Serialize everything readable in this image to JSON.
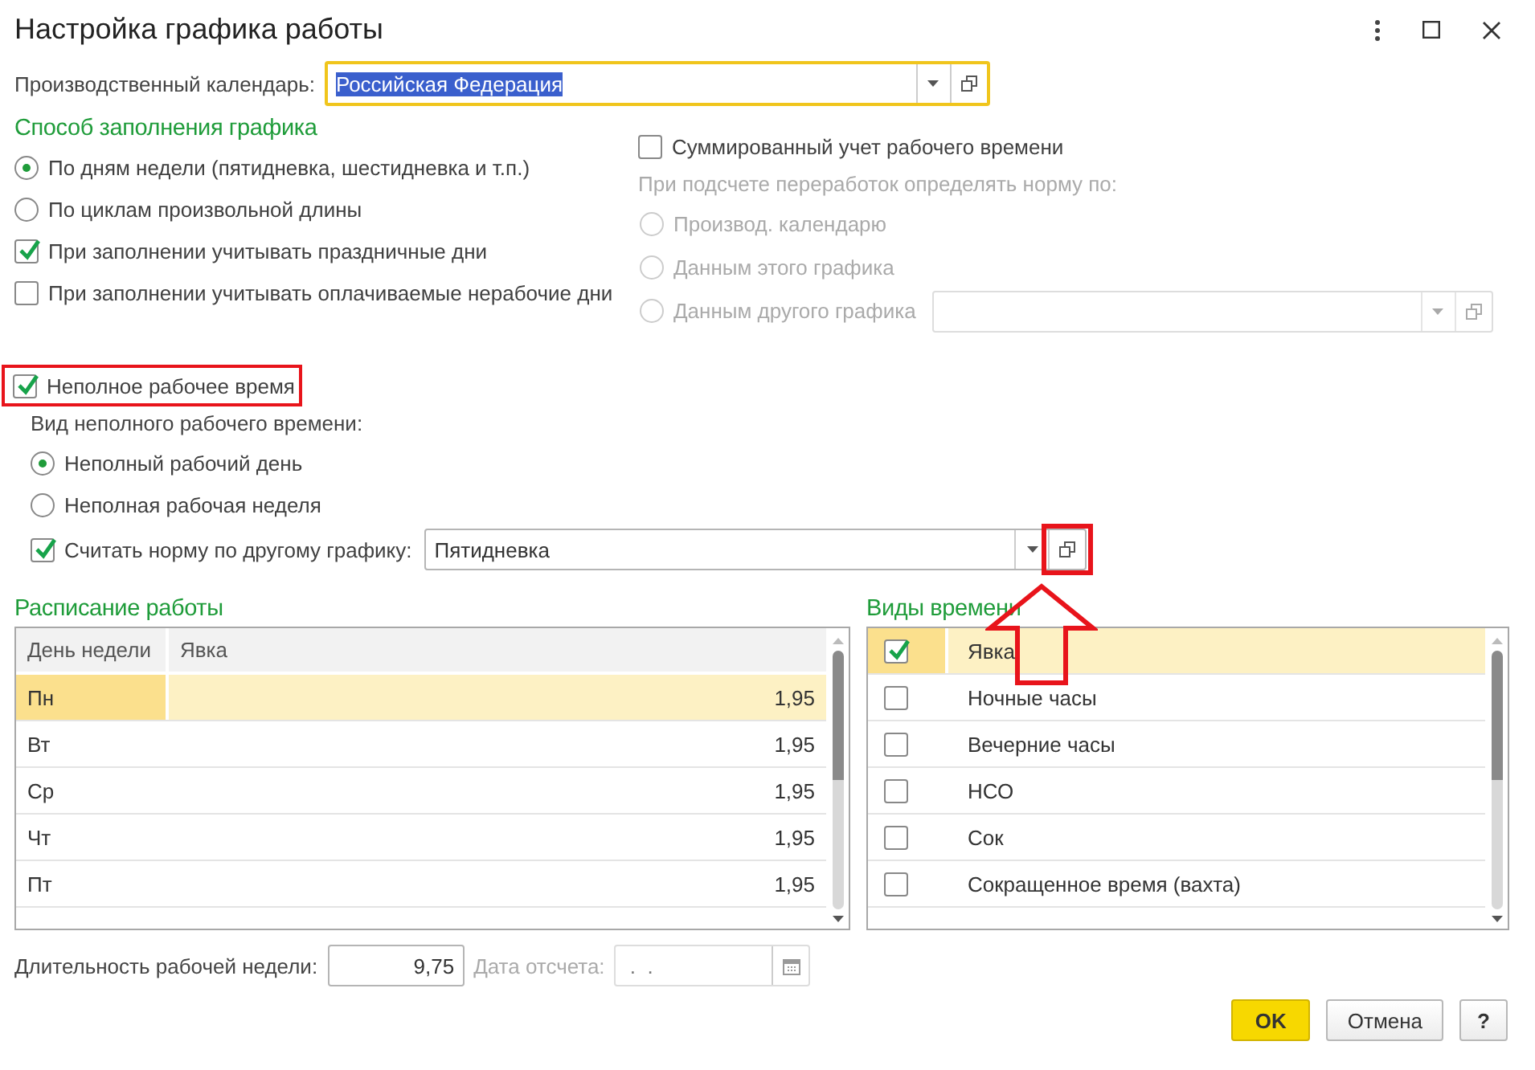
{
  "window": {
    "title": "Настройка графика работы"
  },
  "calendar": {
    "label": "Производственный календарь:",
    "value": "Российская Федерация",
    "focused": true,
    "text_selected": true
  },
  "fill_method": {
    "title": "Способ заполнения графика",
    "options": [
      {
        "kind": "radio",
        "label": "По дням недели (пятидневка, шестидневка и т.п.)",
        "selected": true
      },
      {
        "kind": "radio",
        "label": "По циклам произвольной длины",
        "selected": false
      },
      {
        "kind": "checkbox",
        "label": "При заполнении учитывать праздничные дни",
        "checked": true
      },
      {
        "kind": "checkbox",
        "label": "При заполнении учитывать оплачиваемые нерабочие дни",
        "checked": false
      }
    ]
  },
  "summarized": {
    "label": "Суммированный учет рабочего времени",
    "checked": false
  },
  "overtime_norm": {
    "label": "При подсчете переработок определять норму по:",
    "disabled": true,
    "options": [
      {
        "label": "Производ. календарю",
        "selected": false
      },
      {
        "label": "Данным этого графика",
        "selected": false
      },
      {
        "label": "Данным другого графика",
        "selected": false
      }
    ]
  },
  "part_time": {
    "label": "Неполное рабочее время",
    "checked": true,
    "highlighted": true
  },
  "part_time_kind": {
    "label": "Вид неполного рабочего времени:",
    "options": [
      {
        "label": "Неполный рабочий день",
        "selected": true
      },
      {
        "label": "Неполная рабочая неделя",
        "selected": false
      }
    ]
  },
  "norm_by_schedule": {
    "label": "Считать норму по другому графику:",
    "checked": true,
    "value": "Пятидневка",
    "open_button_highlighted": true
  },
  "schedule": {
    "title": "Расписание работы",
    "columns": [
      "День недели",
      "Явка"
    ],
    "rows": [
      {
        "cells": [
          "Пн",
          "1,95"
        ],
        "selected": true
      },
      {
        "cells": [
          "Вт",
          "1,95"
        ],
        "selected": false
      },
      {
        "cells": [
          "Ср",
          "1,95"
        ],
        "selected": false
      },
      {
        "cells": [
          "Чт",
          "1,95"
        ],
        "selected": false
      },
      {
        "cells": [
          "Пт",
          "1,95"
        ],
        "selected": false
      }
    ]
  },
  "time_types": {
    "title": "Виды времени",
    "items": [
      {
        "label": "Явка",
        "checked": true,
        "selected": true
      },
      {
        "label": "Ночные часы",
        "checked": false,
        "selected": false
      },
      {
        "label": "Вечерние часы",
        "checked": false,
        "selected": false
      },
      {
        "label": "НСО",
        "checked": false,
        "selected": false
      },
      {
        "label": "Сок",
        "checked": false,
        "selected": false
      },
      {
        "label": "Сокращенное время (вахта)",
        "checked": false,
        "selected": false
      }
    ]
  },
  "week_length": {
    "label": "Длительность рабочей недели:",
    "value": "9,75"
  },
  "start_date": {
    "label": "Дата отсчета:",
    "value": " .  .",
    "disabled": true
  },
  "buttons": [
    {
      "label": "OK",
      "kind": "default"
    },
    {
      "label": "Отмена",
      "kind": "normal"
    },
    {
      "label": "?",
      "kind": "help"
    }
  ]
}
